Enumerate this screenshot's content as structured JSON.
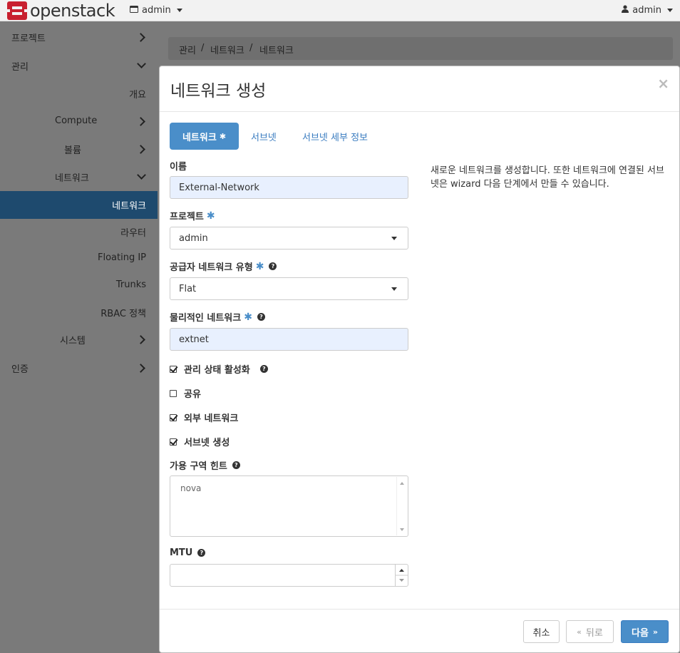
{
  "topbar": {
    "logo_text": "openstack",
    "project_selector": "admin",
    "user_menu": "admin"
  },
  "sidebar": {
    "items": [
      {
        "label": "프로젝트",
        "chevron": "right"
      },
      {
        "label": "관리",
        "chevron": "down"
      },
      {
        "label": "개요"
      },
      {
        "label": "Compute",
        "chevron": "right"
      },
      {
        "label": "볼륨",
        "chevron": "right"
      },
      {
        "label": "네트워크",
        "chevron": "down"
      },
      {
        "label": "네트워크",
        "active": true
      },
      {
        "label": "라우터"
      },
      {
        "label": "Floating IP"
      },
      {
        "label": "Trunks"
      },
      {
        "label": "RBAC 정책"
      },
      {
        "label": "시스템",
        "chevron": "right"
      },
      {
        "label": "인증",
        "chevron": "right"
      }
    ]
  },
  "breadcrumb": [
    "관리",
    "네트워크",
    "네트워크"
  ],
  "modal": {
    "title": "네트워크 생성",
    "close_symbol": "×",
    "tabs": [
      "네트워크",
      "서브넷",
      "서브넷 세부 정보"
    ],
    "active_tab_marker": "✱",
    "fields": {
      "name": {
        "label": "이름",
        "value": "External-Network"
      },
      "project": {
        "label": "프로젝트",
        "value": "admin"
      },
      "provider_type": {
        "label": "공급자 네트워크 유형",
        "value": "Flat"
      },
      "physical_network": {
        "label": "물리적인 네트워크",
        "value": "extnet"
      },
      "admin_state": {
        "label": "관리 상태 활성화",
        "checked": true
      },
      "shared": {
        "label": "공유",
        "checked": false
      },
      "external": {
        "label": "외부 네트워크",
        "checked": true
      },
      "create_subnet": {
        "label": "서브넷 생성",
        "checked": true
      },
      "az_hints": {
        "label": "가용 구역 힌트",
        "options": [
          "nova"
        ]
      },
      "mtu": {
        "label": "MTU",
        "value": ""
      }
    },
    "required_marker": "✱",
    "help_symbol": "?",
    "help_text": "새로운 네트워크를 생성합니다. 또한 네트워크에 연결된 서브넷은 wizard 다음 단계에서 만들 수 있습니다.",
    "buttons": {
      "cancel": "취소",
      "back": "뒤로",
      "back_symbol": "«",
      "next": "다음",
      "next_symbol": "»"
    }
  },
  "colors": {
    "primary": "#4a8ec9",
    "active_nav": "#1e4a6e",
    "input_fill": "#e8f0fe",
    "logo_red": "#c8202f"
  }
}
